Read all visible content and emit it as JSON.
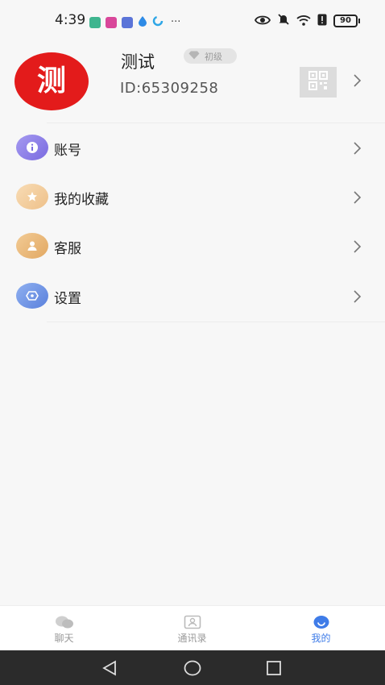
{
  "status_bar": {
    "time": "4:39",
    "dots": "···",
    "battery": "90",
    "icons": [
      "shield-app-icon",
      "chat-app-icon",
      "calendar-app-icon",
      "drop-app-icon",
      "swirl-app-icon",
      "eye-icon",
      "mute-icon",
      "wifi-icon",
      "sim-alert-icon",
      "battery-icon"
    ]
  },
  "profile": {
    "avatar_text": "测",
    "name": "测试",
    "level": "初级",
    "id": "ID:65309258"
  },
  "menu": [
    {
      "label": "账号",
      "icon": "info-icon",
      "color": "#8a7de6"
    },
    {
      "label": "我的收藏",
      "icon": "star-icon",
      "color": "#f0c48a"
    },
    {
      "label": "客服",
      "icon": "person-icon",
      "color": "#e8b574"
    },
    {
      "label": "设置",
      "icon": "settings-icon",
      "color": "#6a8fe4"
    }
  ],
  "tabs": [
    {
      "label": "聊天",
      "icon": "chat-bubbles-icon",
      "active": false
    },
    {
      "label": "通讯录",
      "icon": "contacts-icon",
      "active": false
    },
    {
      "label": "我的",
      "icon": "me-icon",
      "active": true
    }
  ],
  "colors": {
    "accent": "#3f7ce8",
    "avatar_bg": "#e31b1b",
    "page_bg": "#f7f7f7",
    "navbar_bg": "#2b2b2b"
  }
}
